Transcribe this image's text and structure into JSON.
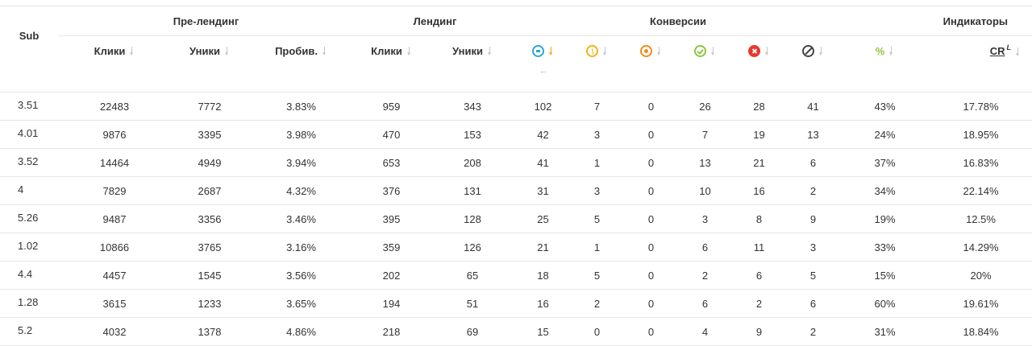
{
  "header": {
    "sub": "Sub",
    "groups": {
      "prelanding": "Пре-лендинг",
      "landing": "Лендинг",
      "conversions": "Конверсии",
      "indicators": "Индикаторы"
    },
    "columns": {
      "pre_clicks": "Клики",
      "pre_uniques": "Уники",
      "pre_breakthrough": "Пробив.",
      "land_clicks": "Клики",
      "land_uniques": "Уники",
      "pct": "%",
      "cr": "CR"
    },
    "icons": {
      "new": "arrow-right-circle-icon",
      "hold": "clock-icon",
      "pending": "dot-circle-icon",
      "approved": "check-circle-icon",
      "rejected": "x-circle-icon",
      "trash": "ban-icon"
    },
    "sorted_column": "conv_new",
    "sort_direction": "desc"
  },
  "colors": {
    "new": "#2ba7d8",
    "hold": "#f2b318",
    "pending": "#f08c1a",
    "approved": "#8cc63f",
    "rejected": "#e8392b",
    "trash": "#555555"
  },
  "rows": [
    {
      "sub": "3.51",
      "pre_clicks": "22483",
      "pre_uniques": "7772",
      "pre_breakthrough": "3.83%",
      "land_clicks": "959",
      "land_uniques": "343",
      "conv_new": "102",
      "conv_hold": "7",
      "conv_pending": "0",
      "conv_approved": "26",
      "conv_rejected": "28",
      "conv_trash": "41",
      "pct": "43%",
      "cr": "17.78%"
    },
    {
      "sub": "4.01",
      "pre_clicks": "9876",
      "pre_uniques": "3395",
      "pre_breakthrough": "3.98%",
      "land_clicks": "470",
      "land_uniques": "153",
      "conv_new": "42",
      "conv_hold": "3",
      "conv_pending": "0",
      "conv_approved": "7",
      "conv_rejected": "19",
      "conv_trash": "13",
      "pct": "24%",
      "cr": "18.95%"
    },
    {
      "sub": "3.52",
      "pre_clicks": "14464",
      "pre_uniques": "4949",
      "pre_breakthrough": "3.94%",
      "land_clicks": "653",
      "land_uniques": "208",
      "conv_new": "41",
      "conv_hold": "1",
      "conv_pending": "0",
      "conv_approved": "13",
      "conv_rejected": "21",
      "conv_trash": "6",
      "pct": "37%",
      "cr": "16.83%"
    },
    {
      "sub": "4",
      "pre_clicks": "7829",
      "pre_uniques": "2687",
      "pre_breakthrough": "4.32%",
      "land_clicks": "376",
      "land_uniques": "131",
      "conv_new": "31",
      "conv_hold": "3",
      "conv_pending": "0",
      "conv_approved": "10",
      "conv_rejected": "16",
      "conv_trash": "2",
      "pct": "34%",
      "cr": "22.14%"
    },
    {
      "sub": "5.26",
      "pre_clicks": "9487",
      "pre_uniques": "3356",
      "pre_breakthrough": "3.46%",
      "land_clicks": "395",
      "land_uniques": "128",
      "conv_new": "25",
      "conv_hold": "5",
      "conv_pending": "0",
      "conv_approved": "3",
      "conv_rejected": "8",
      "conv_trash": "9",
      "pct": "19%",
      "cr": "12.5%"
    },
    {
      "sub": "1.02",
      "pre_clicks": "10866",
      "pre_uniques": "3765",
      "pre_breakthrough": "3.16%",
      "land_clicks": "359",
      "land_uniques": "126",
      "conv_new": "21",
      "conv_hold": "1",
      "conv_pending": "0",
      "conv_approved": "6",
      "conv_rejected": "11",
      "conv_trash": "3",
      "pct": "33%",
      "cr": "14.29%"
    },
    {
      "sub": "4.4",
      "pre_clicks": "4457",
      "pre_uniques": "1545",
      "pre_breakthrough": "3.56%",
      "land_clicks": "202",
      "land_uniques": "65",
      "conv_new": "18",
      "conv_hold": "5",
      "conv_pending": "0",
      "conv_approved": "2",
      "conv_rejected": "6",
      "conv_trash": "5",
      "pct": "15%",
      "cr": "20%"
    },
    {
      "sub": "1.28",
      "pre_clicks": "3615",
      "pre_uniques": "1233",
      "pre_breakthrough": "3.65%",
      "land_clicks": "194",
      "land_uniques": "51",
      "conv_new": "16",
      "conv_hold": "2",
      "conv_pending": "0",
      "conv_approved": "6",
      "conv_rejected": "2",
      "conv_trash": "6",
      "pct": "60%",
      "cr": "19.61%"
    },
    {
      "sub": "5.2",
      "pre_clicks": "4032",
      "pre_uniques": "1378",
      "pre_breakthrough": "4.86%",
      "land_clicks": "218",
      "land_uniques": "69",
      "conv_new": "15",
      "conv_hold": "0",
      "conv_pending": "0",
      "conv_approved": "4",
      "conv_rejected": "9",
      "conv_trash": "2",
      "pct": "31%",
      "cr": "18.84%"
    }
  ]
}
